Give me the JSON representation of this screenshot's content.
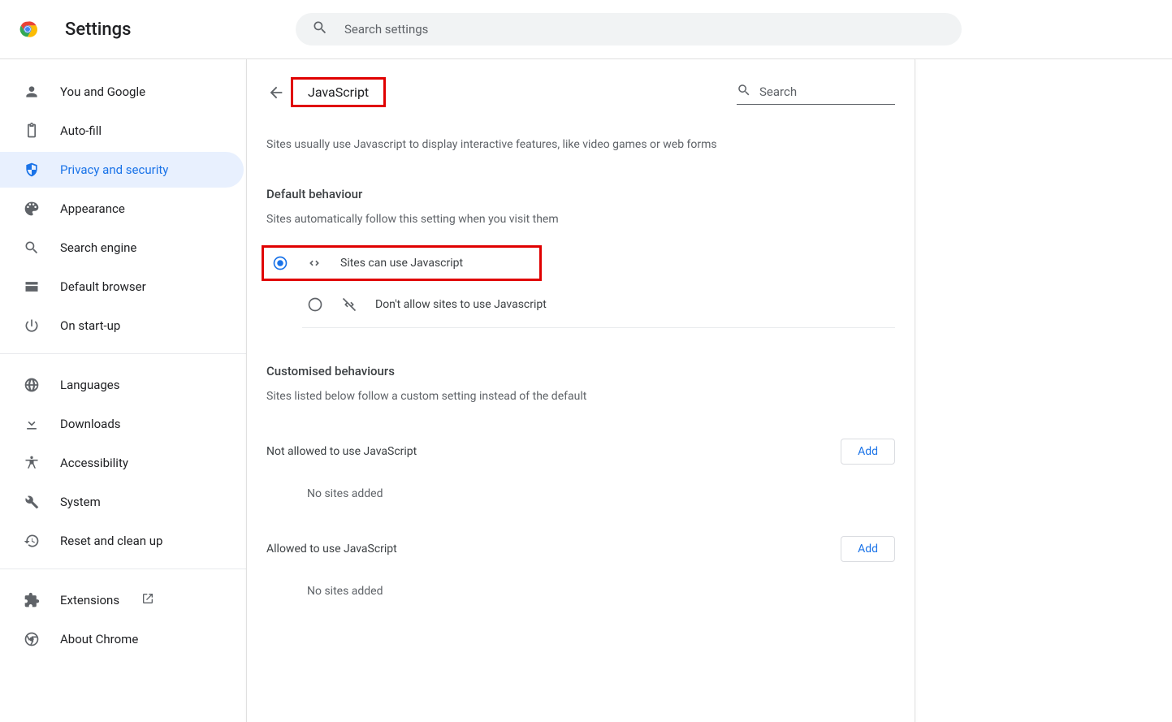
{
  "header": {
    "app_title": "Settings",
    "search_placeholder": "Search settings"
  },
  "sidebar": {
    "items": [
      {
        "label": "You and Google",
        "icon": "person"
      },
      {
        "label": "Auto-fill",
        "icon": "clipboard"
      },
      {
        "label": "Privacy and security",
        "icon": "shield",
        "active": true
      },
      {
        "label": "Appearance",
        "icon": "palette"
      },
      {
        "label": "Search engine",
        "icon": "search"
      },
      {
        "label": "Default browser",
        "icon": "window"
      },
      {
        "label": "On start-up",
        "icon": "power"
      }
    ],
    "items2": [
      {
        "label": "Languages",
        "icon": "globe"
      },
      {
        "label": "Downloads",
        "icon": "download"
      },
      {
        "label": "Accessibility",
        "icon": "accessibility"
      },
      {
        "label": "System",
        "icon": "wrench"
      },
      {
        "label": "Reset and clean up",
        "icon": "restore"
      }
    ],
    "items3": [
      {
        "label": "Extensions",
        "icon": "puzzle",
        "external": true
      },
      {
        "label": "About Chrome",
        "icon": "chrome"
      }
    ]
  },
  "main": {
    "page_title": "JavaScript",
    "content_search_placeholder": "Search",
    "description": "Sites usually use Javascript to display interactive features, like video games or web forms",
    "default_behaviour_title": "Default behaviour",
    "default_behaviour_sub": "Sites automatically follow this setting when you visit them",
    "radio_allow_label": "Sites can use Javascript",
    "radio_block_label": "Don't allow sites to use Javascript",
    "custom_title": "Customised behaviours",
    "custom_sub": "Sites listed below follow a custom setting instead of the default",
    "not_allowed_label": "Not allowed to use JavaScript",
    "allowed_label": "Allowed to use JavaScript",
    "add_label": "Add",
    "no_sites_label": "No sites added"
  }
}
